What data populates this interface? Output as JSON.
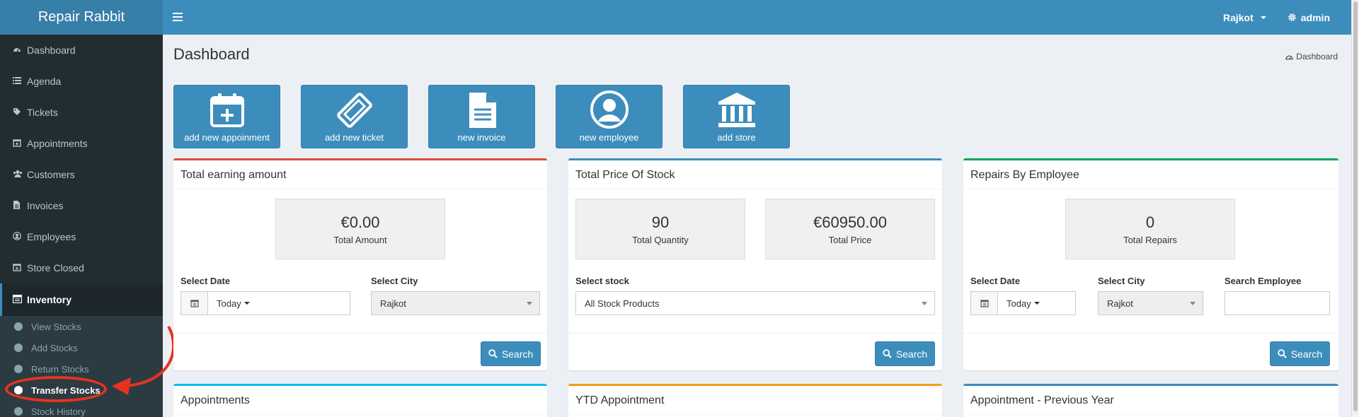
{
  "app": {
    "title": "Repair Rabbit"
  },
  "topbar": {
    "city": "Rajkot",
    "user": "admin"
  },
  "sidebar": {
    "items": [
      {
        "label": "Dashboard",
        "icon": "dashboard-icon"
      },
      {
        "label": "Agenda",
        "icon": "list-icon"
      },
      {
        "label": "Tickets",
        "icon": "tag-icon"
      },
      {
        "label": "Appointments",
        "icon": "calendar-plus-icon"
      },
      {
        "label": "Customers",
        "icon": "users-icon"
      },
      {
        "label": "Invoices",
        "icon": "file-icon"
      },
      {
        "label": "Employees",
        "icon": "user-circle-icon"
      },
      {
        "label": "Store Closed",
        "icon": "calendar-x-icon"
      },
      {
        "label": "Inventory",
        "icon": "inventory-icon"
      }
    ],
    "submenu": [
      {
        "label": "View Stocks"
      },
      {
        "label": "Add Stocks"
      },
      {
        "label": "Return Stocks"
      },
      {
        "label": "Transfer Stocks"
      },
      {
        "label": "Stock History"
      }
    ]
  },
  "page": {
    "title": "Dashboard",
    "breadcrumb": "Dashboard"
  },
  "tiles": [
    {
      "label": "add new appoinment",
      "icon": "calendar-plus-icon"
    },
    {
      "label": "add new ticket",
      "icon": "ticket-icon"
    },
    {
      "label": "new invoice",
      "icon": "document-icon"
    },
    {
      "label": "new employee",
      "icon": "user-circle-icon"
    },
    {
      "label": "add store",
      "icon": "bank-icon"
    }
  ],
  "earning": {
    "title": "Total earning amount",
    "amount": "€0.00",
    "amount_label": "Total Amount",
    "date_label": "Select Date",
    "date_value": "Today",
    "city_label": "Select City",
    "city_value": "Rajkot",
    "search": "Search",
    "color": "#dd4b39"
  },
  "stock": {
    "title": "Total Price Of Stock",
    "quantity": "90",
    "quantity_label": "Total Quantity",
    "price": "€60950.00",
    "price_label": "Total Price",
    "select_label": "Select stock",
    "select_value": "All Stock Products",
    "search": "Search",
    "color": "#3c8dbc"
  },
  "repairs": {
    "title": "Repairs By Employee",
    "count": "0",
    "count_label": "Total Repairs",
    "date_label": "Select Date",
    "date_value": "Today",
    "city_label": "Select City",
    "city_value": "Rajkot",
    "employee_label": "Search Employee",
    "employee_value": "",
    "search": "Search",
    "color": "#00a65a"
  },
  "bottom_boxes": [
    {
      "title": "Appointments",
      "color": "#00c0ef"
    },
    {
      "title": "YTD Appointment",
      "color": "#f39c12"
    },
    {
      "title": "Appointment - Previous Year",
      "color": "#3c8dbc"
    }
  ]
}
